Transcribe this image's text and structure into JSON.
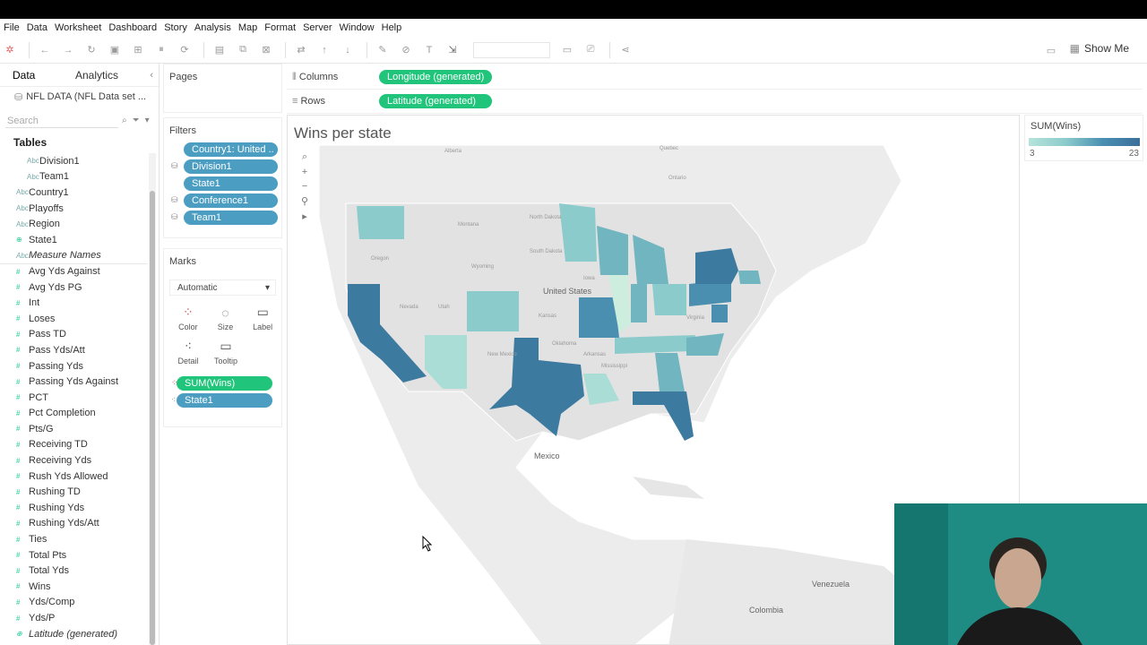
{
  "menu": [
    "File",
    "Data",
    "Worksheet",
    "Dashboard",
    "Story",
    "Analysis",
    "Map",
    "Format",
    "Server",
    "Window",
    "Help"
  ],
  "toolbar": {
    "show_me": "Show Me"
  },
  "left_panel": {
    "tabs": [
      "Data",
      "Analytics"
    ],
    "datasource": "NFL DATA (NFL Data set ...",
    "search_placeholder": "Search",
    "tables_header": "Tables",
    "fields": [
      {
        "name": "Division1",
        "indent": true,
        "type": "abc"
      },
      {
        "name": "Team1",
        "indent": true,
        "type": "abc"
      },
      {
        "name": "Country1",
        "type": "abc"
      },
      {
        "name": "Playoffs",
        "type": "abc"
      },
      {
        "name": "Region",
        "type": "abc"
      },
      {
        "name": "State1",
        "type": "geo"
      },
      {
        "name": "Measure Names",
        "type": "abc",
        "italic": true
      },
      {
        "name": "Avg Yds Against",
        "type": "num"
      },
      {
        "name": "Avg Yds PG",
        "type": "num"
      },
      {
        "name": "Int",
        "type": "num"
      },
      {
        "name": "Loses",
        "type": "num"
      },
      {
        "name": "Pass TD",
        "type": "num"
      },
      {
        "name": "Pass Yds/Att",
        "type": "num"
      },
      {
        "name": "Passing Yds",
        "type": "num"
      },
      {
        "name": "Passing Yds Against",
        "type": "num"
      },
      {
        "name": "PCT",
        "type": "num"
      },
      {
        "name": "Pct Completion",
        "type": "num"
      },
      {
        "name": "Pts/G",
        "type": "num"
      },
      {
        "name": "Receiving TD",
        "type": "num"
      },
      {
        "name": "Receiving Yds",
        "type": "num"
      },
      {
        "name": "Rush Yds Allowed",
        "type": "num"
      },
      {
        "name": "Rushing TD",
        "type": "num"
      },
      {
        "name": "Rushing Yds",
        "type": "num"
      },
      {
        "name": "Rushing Yds/Att",
        "type": "num"
      },
      {
        "name": "Ties",
        "type": "num"
      },
      {
        "name": "Total Pts",
        "type": "num"
      },
      {
        "name": "Total Yds",
        "type": "num"
      },
      {
        "name": "Wins",
        "type": "num"
      },
      {
        "name": "Yds/Comp",
        "type": "num"
      },
      {
        "name": "Yds/P",
        "type": "num"
      },
      {
        "name": "Latitude (generated)",
        "type": "geo",
        "italic": true
      }
    ]
  },
  "pages": {
    "title": "Pages"
  },
  "filters": {
    "title": "Filters",
    "items": [
      "Country1: United ..",
      "Division1",
      "State1",
      "Conference1",
      "Team1"
    ]
  },
  "marks": {
    "title": "Marks",
    "type": "Automatic",
    "buttons": [
      "Color",
      "Size",
      "Label",
      "Detail",
      "Tooltip"
    ],
    "pills": [
      "SUM(Wins)",
      "State1"
    ]
  },
  "shelves": {
    "columns_label": "Columns",
    "columns_pill": "Longitude (generated)",
    "rows_label": "Rows",
    "rows_pill": "Latitude (generated)"
  },
  "view": {
    "title": "Wins per state",
    "map_labels": [
      "Alberta",
      "Quebec",
      "Ontario",
      "Montana",
      "North Dakota",
      "South Dakota",
      "Wyoming",
      "Oregon",
      "Nevada",
      "Utah",
      "United States",
      "Kansas",
      "Iowa",
      "Oklahoma",
      "Arkansas",
      "Mississippi",
      "New Mexico",
      "Virginia",
      "Mexico",
      "Venezuela",
      "Colombia"
    ]
  },
  "legend": {
    "title": "SUM(Wins)",
    "min": "3",
    "max": "23",
    "colors": [
      "#b6e3db",
      "#3a6f99"
    ]
  }
}
